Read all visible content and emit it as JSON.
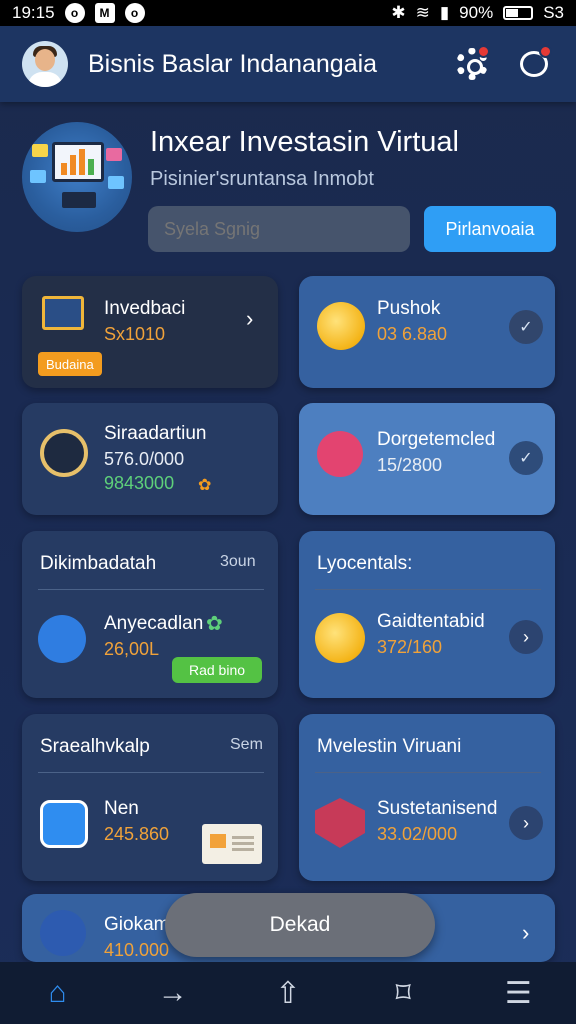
{
  "status_bar": {
    "time": "19:15",
    "icons_left": [
      "o",
      "M",
      "o"
    ],
    "battery": "90%",
    "carrier": "S3"
  },
  "app_bar": {
    "title": "Bisnis Baslar Indanangaia",
    "settings_icon": "gear-icon",
    "chat_icon": "chat-bubble-icon"
  },
  "hero": {
    "title": "Inxear Investasin Virtual",
    "subtitle": "Pisinier'sruntansa Inmobt",
    "input_placeholder": "Syela Sgnig",
    "button": "Pirlanvoaia"
  },
  "cards": {
    "c1": {
      "title": "Invedbaci",
      "value": "Sx1010",
      "tag": "Budaina"
    },
    "c2": {
      "title": "Pushok",
      "value": "03 6.8a0"
    },
    "c3": {
      "title": "Siraadartiun",
      "value": "576.0/000",
      "value2": "9843000"
    },
    "c4": {
      "title": "Dorgetemcled",
      "value": "15/2800"
    },
    "c5": {
      "heading": "Dikimbadatah",
      "meta": "3oun",
      "title": "Anyecadlan",
      "value": "26,00L",
      "button": "Rad bino"
    },
    "c6": {
      "heading": "Lyocentals:",
      "title": "Gaidtentabid",
      "value": "372/160"
    },
    "c7": {
      "heading": "Sraealhvkalp",
      "meta": "Sem",
      "title": "Nen",
      "value": "245.860"
    },
    "c8": {
      "heading": "Mvelestin Viruani",
      "title": "Sustetanisend",
      "value": "33.02/000"
    },
    "c9": {
      "title": "Giokam",
      "value": "410.000"
    }
  },
  "toast": {
    "label": "Dekad"
  },
  "bottom_nav": [
    {
      "name": "home",
      "icon": "⌂"
    },
    {
      "name": "forward",
      "icon": "→"
    },
    {
      "name": "share",
      "icon": "⇧"
    },
    {
      "name": "bookmark",
      "icon": "⌑"
    },
    {
      "name": "menu",
      "icon": "☰"
    }
  ],
  "colors": {
    "accent": "#2f9ef5",
    "value_orange": "#f0a23a",
    "value_green": "#5ed07a",
    "bg": "#1b2a4d"
  }
}
